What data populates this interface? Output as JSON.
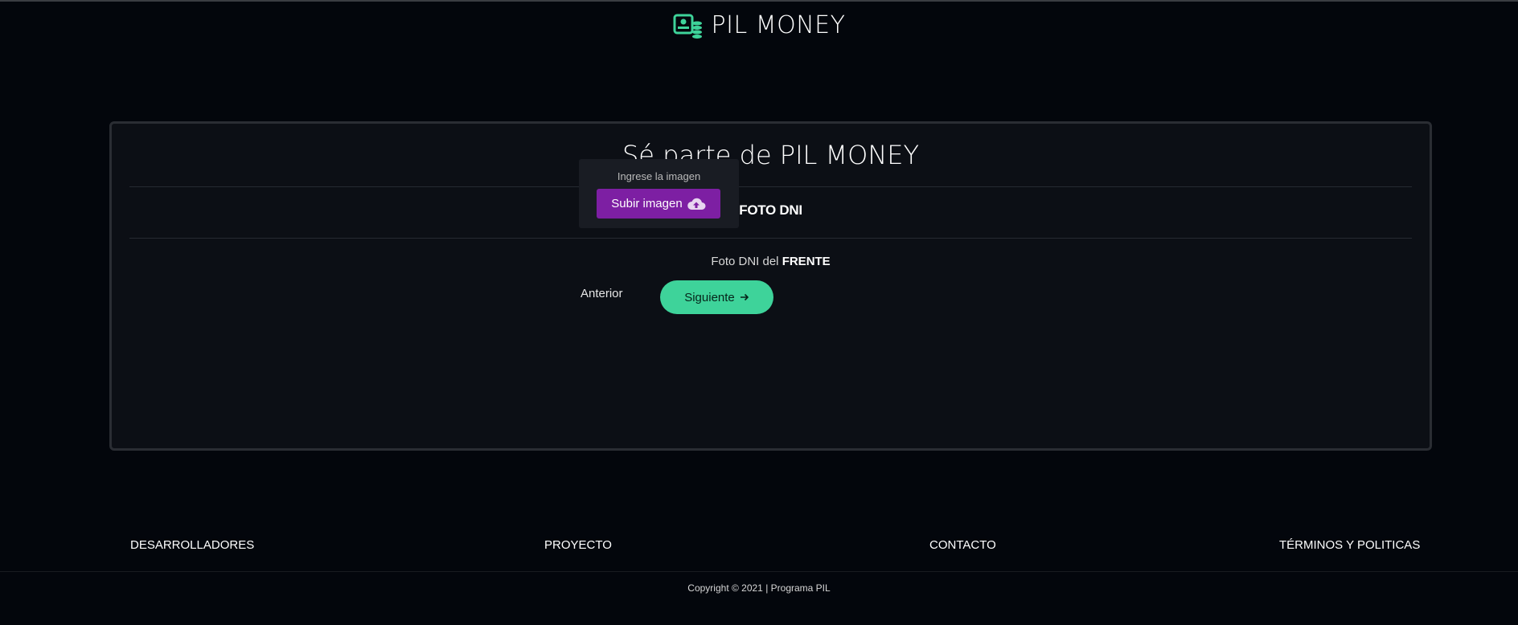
{
  "header": {
    "brand_name": "PIL MONEY",
    "brand_icon": "money-stack-icon",
    "brand_color": "#3ed39a"
  },
  "form": {
    "title": "Sé parte de PIL MONEY",
    "section_title": "FOTO DNI",
    "field_label_prefix": "Foto DNI del",
    "field_label_emphasis": "FRENTE",
    "upload_hint": "Ingrese la imagen",
    "upload_button_label": "Subir imagen",
    "upload_button_icon": "cloud-upload-icon",
    "upload_button_color": "#7d1fa3",
    "prev_label": "Anterior",
    "next_label": "Siguiente",
    "next_icon": "arrow-right-icon",
    "next_button_color": "#3ed39a"
  },
  "footer": {
    "links": [
      "DESARROLLADORES",
      "PROYECTO",
      "CONTACTO",
      "TÉRMINOS Y POLITICAS"
    ],
    "copyright": "Copyright © 2021 | Programa PIL"
  }
}
